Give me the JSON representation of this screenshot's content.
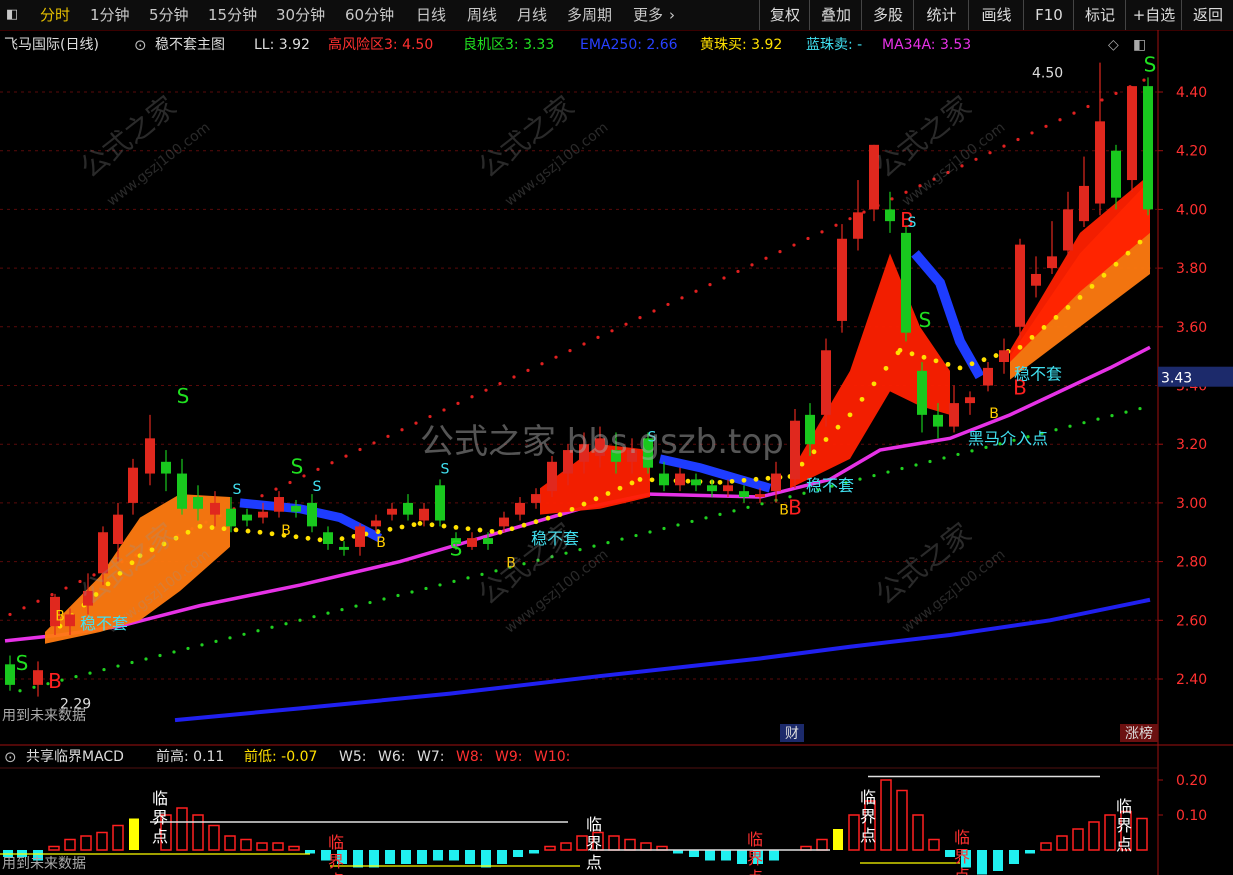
{
  "toolbar": {
    "tabs": [
      "分时",
      "1分钟",
      "5分钟",
      "15分钟",
      "30分钟",
      "60分钟",
      "日线",
      "周线",
      "月线",
      "多周期",
      "更多"
    ],
    "active_tab": "分时",
    "right_buttons": [
      "复权",
      "叠加",
      "多股",
      "统计",
      "画线",
      "F10",
      "标记",
      "+自选",
      "返回"
    ]
  },
  "info": {
    "stock": "飞马国际(日线)",
    "formula": "稳不套主图",
    "ll": "LL: 3.92",
    "high_risk": "高风险区3: 4.50",
    "good_zone": "良机区3: 3.33",
    "ema250": "EMA250: 2.66",
    "yellow_buy": "黄珠买: 3.92",
    "blue_sell": "蓝珠卖: -",
    "ma34a": "MA34A: 3.53"
  },
  "price_axis": {
    "ticks": [
      "4.40",
      "4.20",
      "4.00",
      "3.80",
      "3.60",
      "3.40",
      "3.20",
      "3.00",
      "2.80",
      "2.60",
      "2.40"
    ],
    "current": "3.43",
    "high_mark": "4.50",
    "low_mark": "2.29"
  },
  "annotations": {
    "wen_bu_tao": "稳不套",
    "hei_ma": "黑马介入点",
    "buy": "B",
    "sell": "S",
    "cai": "财",
    "zhang_bang": "涨榜",
    "future_data": "用到未来数据",
    "lin_jie": "临界点"
  },
  "watermark": {
    "center": "公式之家 bbs.gszb.top",
    "diagonal_cn": "公式之家",
    "diagonal_url": "www.gszj100.com"
  },
  "macd": {
    "title": "共享临界MACD",
    "prev_high": "前高: 0.11",
    "prev_low": "前低: -0.07",
    "w5": "W5:",
    "w6": "W6:",
    "w7": "W7:",
    "w8": "W8:",
    "w9": "W9:",
    "w10": "W10:",
    "axis": [
      "0.20",
      "0.10"
    ]
  },
  "colors": {
    "up": "#e0281e",
    "down": "#19c81e",
    "ma34a": "#e632e6",
    "ema250": "#2020f0",
    "fan_red": "#ff2000",
    "fan_orange": "#ff7a10",
    "yellow": "#ffe000",
    "cyan": "#40e0f0",
    "blue_seg": "#1e3cff"
  }
}
